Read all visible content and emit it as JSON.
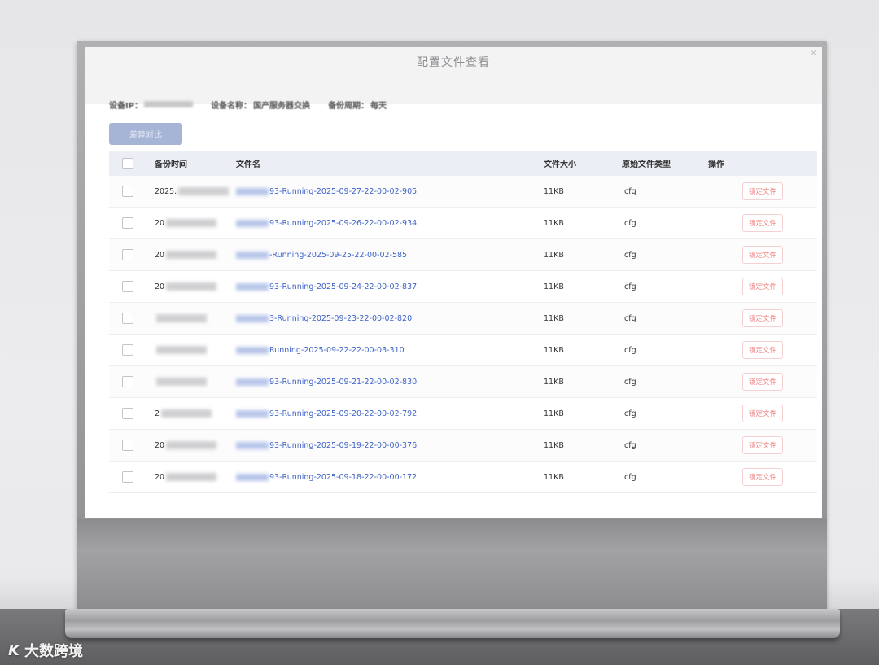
{
  "dialog": {
    "title": "配置文件查看",
    "close_icon": "×"
  },
  "info": {
    "ip_label": "设备IP：",
    "name_label": "设备名称：",
    "name_value": "国产服务器交换",
    "period_label": "备份周期：",
    "period_value": "每天"
  },
  "toolbar": {
    "diff_label": "差异对比"
  },
  "table": {
    "headers": {
      "time": "备份时间",
      "name": "文件名",
      "size": "文件大小",
      "type": "原始文件类型",
      "op": "操作"
    },
    "rows": [
      {
        "time": "2025.",
        "name": "93-Running-2025-09-27-22-00-02-905",
        "size": "11KB",
        "type": ".cfg",
        "op": "锁定文件"
      },
      {
        "time": "20",
        "name": "93-Running-2025-09-26-22-00-02-934",
        "size": "11KB",
        "type": ".cfg",
        "op": "锁定文件"
      },
      {
        "time": "20",
        "name": "-Running-2025-09-25-22-00-02-585",
        "size": "11KB",
        "type": ".cfg",
        "op": "锁定文件"
      },
      {
        "time": "20",
        "name": "93-Running-2025-09-24-22-00-02-837",
        "size": "11KB",
        "type": ".cfg",
        "op": "锁定文件"
      },
      {
        "time": "",
        "name": "3-Running-2025-09-23-22-00-02-820",
        "size": "11KB",
        "type": ".cfg",
        "op": "锁定文件"
      },
      {
        "time": "",
        "name": "Running-2025-09-22-22-00-03-310",
        "size": "11KB",
        "type": ".cfg",
        "op": "锁定文件"
      },
      {
        "time": "",
        "name": "93-Running-2025-09-21-22-00-02-830",
        "size": "11KB",
        "type": ".cfg",
        "op": "锁定文件"
      },
      {
        "time": "2",
        "name": "93-Running-2025-09-20-22-00-02-792",
        "size": "11KB",
        "type": ".cfg",
        "op": "锁定文件"
      },
      {
        "time": "20",
        "name": "93-Running-2025-09-19-22-00-00-376",
        "size": "11KB",
        "type": ".cfg",
        "op": "锁定文件"
      },
      {
        "time": "20",
        "name": "93-Running-2025-09-18-22-00-00-172",
        "size": "11KB",
        "type": ".cfg",
        "op": "锁定文件"
      }
    ]
  },
  "watermark": {
    "logo": "K",
    "text": "大数跨境"
  },
  "colors": {
    "link": "#3e63c8",
    "lock": "#f08080",
    "diff_button": "#a6b4d6",
    "header_bg": "#eceef5"
  }
}
